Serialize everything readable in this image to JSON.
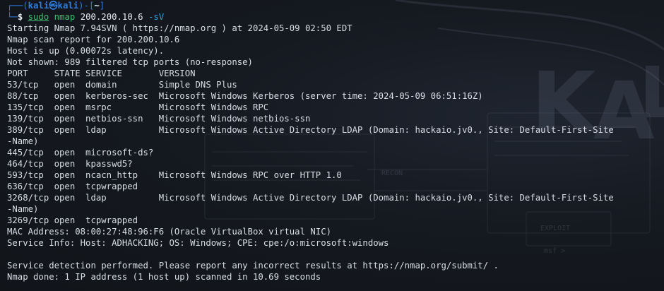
{
  "prompt": {
    "frame_top_left": "┌──(",
    "user_host": "kali㉿kali",
    "frame_mid": ")-[",
    "cwd": "~",
    "frame_end": "]",
    "frame_bottom": "└─",
    "symbol": "$ ",
    "cmd_sudo": "sudo",
    "cmd_name": "nmap",
    "cmd_target": "200.200.10.6",
    "cmd_flag": "-sV"
  },
  "output_lines": [
    "Starting Nmap 7.94SVN ( https://nmap.org ) at 2024-05-09 02:50 EDT",
    "Nmap scan report for 200.200.10.6",
    "Host is up (0.00072s latency).",
    "Not shown: 989 filtered tcp ports (no-response)",
    "PORT     STATE SERVICE       VERSION",
    "53/tcp   open  domain        Simple DNS Plus",
    "88/tcp   open  kerberos-sec  Microsoft Windows Kerberos (server time: 2024-05-09 06:51:16Z)",
    "135/tcp  open  msrpc         Microsoft Windows RPC",
    "139/tcp  open  netbios-ssn   Microsoft Windows netbios-ssn",
    "389/tcp  open  ldap          Microsoft Windows Active Directory LDAP (Domain: hackaio.jv0., Site: Default-First-Site",
    "-Name)",
    "445/tcp  open  microsoft-ds?",
    "464/tcp  open  kpasswd5?",
    "593/tcp  open  ncacn_http    Microsoft Windows RPC over HTTP 1.0",
    "636/tcp  open  tcpwrapped",
    "3268/tcp open  ldap          Microsoft Windows Active Directory LDAP (Domain: hackaio.jv0., Site: Default-First-Site",
    "-Name)",
    "3269/tcp open  tcpwrapped",
    "MAC Address: 08:00:27:48:96:F6 (Oracle VirtualBox virtual NIC)",
    "Service Info: Host: ADHACKING; OS: Windows; CPE: cpe:/o:microsoft:windows",
    "",
    "Service detection performed. Please report any incorrect results at https://nmap.org/submit/ .",
    "Nmap done: 1 IP address (1 host up) scanned in 10.69 seconds"
  ],
  "wallpaper": {
    "labels": [
      "RECON",
      "EXPLOIT",
      "msf >"
    ]
  },
  "colors": {
    "background": "#151920",
    "text": "#d8dde6",
    "prompt_blue": "#2f7de1",
    "command_green": "#3fbf6f"
  }
}
